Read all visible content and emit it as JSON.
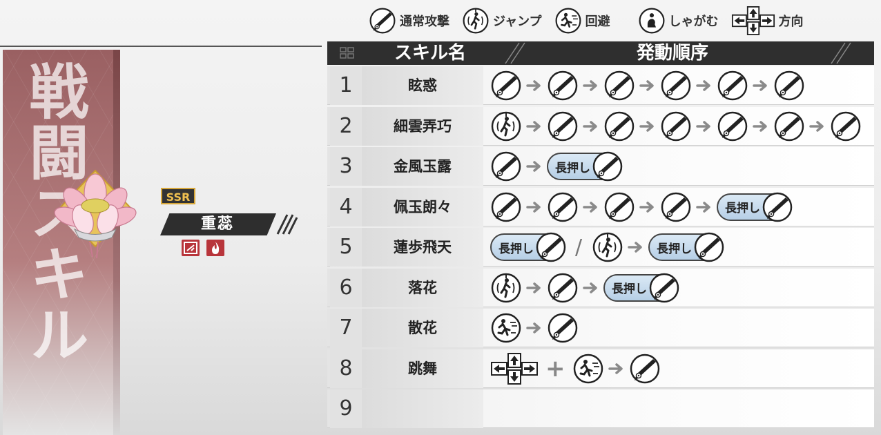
{
  "legend": [
    {
      "icon": "sword-icon",
      "label": "通常攻撃"
    },
    {
      "icon": "jump-icon",
      "label": "ジャンプ"
    },
    {
      "icon": "dodge-icon",
      "label": "回避"
    },
    {
      "icon": "crouch-icon",
      "label": "しゃがむ"
    },
    {
      "icon": "dpad-icon",
      "label": "方向"
    }
  ],
  "panel": {
    "vertical_title": "戦闘スキル",
    "rarity": "SSR",
    "character_name": "重蕊",
    "element_icons": [
      "blade-element-icon",
      "fire-element-icon"
    ]
  },
  "table": {
    "header_skill": "スキル名",
    "header_order": "発動順序",
    "hold_label": "長押し",
    "rows": [
      {
        "num": "1",
        "name": "眩惑"
      },
      {
        "num": "2",
        "name": "細雲弄巧"
      },
      {
        "num": "3",
        "name": "金風玉露"
      },
      {
        "num": "4",
        "name": "佩玉朗々"
      },
      {
        "num": "5",
        "name": "蓮歩飛天"
      },
      {
        "num": "6",
        "name": "落花"
      },
      {
        "num": "7",
        "name": "散花"
      },
      {
        "num": "8",
        "name": "跳舞"
      },
      {
        "num": "9",
        "name": ""
      }
    ]
  },
  "colors": {
    "panel": "#a76b6d",
    "header": "#2f2f2f",
    "hold_bg": "#c8dbee",
    "rarity_text": "#f0c050"
  }
}
